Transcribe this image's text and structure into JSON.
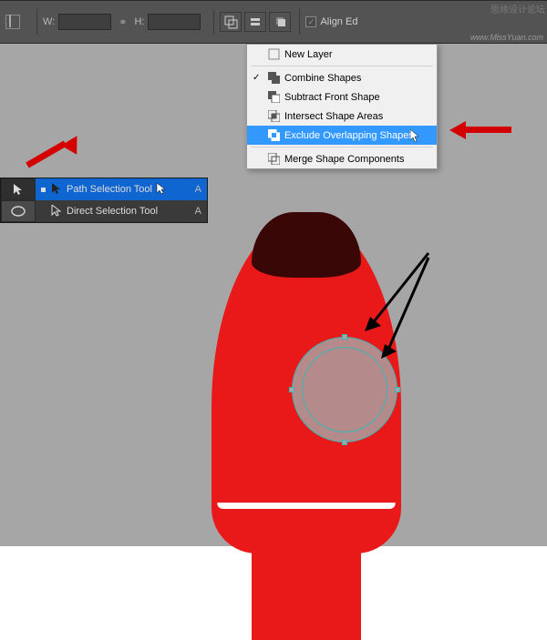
{
  "toolbar": {
    "w_label": "W:",
    "w_value": "",
    "h_label": "H:",
    "h_value": "",
    "align_edges_label": "Align Ed",
    "align_edges_checked": true
  },
  "dropdown": {
    "items": [
      {
        "label": "New Layer",
        "checked": false,
        "highlighted": false
      },
      {
        "label": "Combine Shapes",
        "checked": true,
        "highlighted": false
      },
      {
        "label": "Subtract Front Shape",
        "checked": false,
        "highlighted": false
      },
      {
        "label": "Intersect Shape Areas",
        "checked": false,
        "highlighted": false
      },
      {
        "label": "Exclude Overlapping Shapes",
        "checked": false,
        "highlighted": true
      },
      {
        "label": "Merge Shape Components",
        "checked": false,
        "highlighted": false
      }
    ]
  },
  "tool_flyout": {
    "items": [
      {
        "label": "Path Selection Tool",
        "shortcut": "A",
        "selected": true
      },
      {
        "label": "Direct Selection Tool",
        "shortcut": "A",
        "selected": false
      }
    ]
  },
  "watermark": {
    "top": "思缘设计论坛",
    "bottom": "www.MissYuan.com"
  },
  "colors": {
    "rocket_body": "#ea1919",
    "rocket_tip": "#3a0707",
    "canvas_bg": "#a6a6a6",
    "highlight": "#3399ff",
    "arrow_red": "#d40000"
  }
}
